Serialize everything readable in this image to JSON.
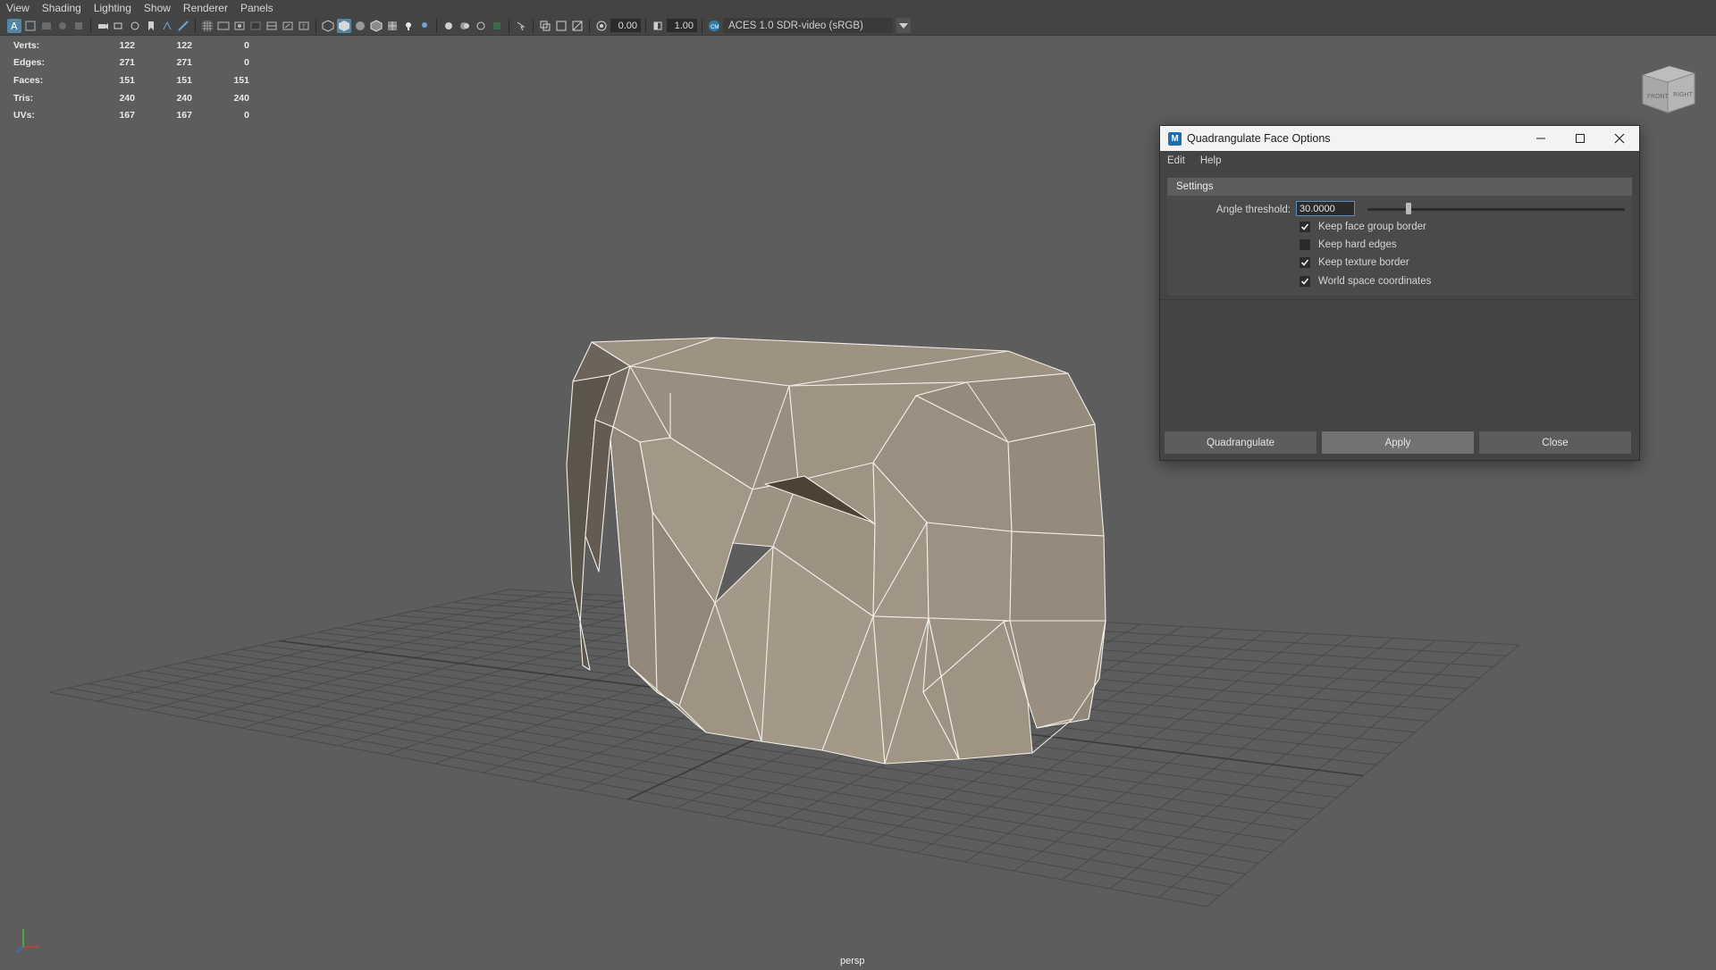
{
  "menubar": {
    "items": [
      "View",
      "Shading",
      "Lighting",
      "Show",
      "Renderer",
      "Panels"
    ]
  },
  "toolbar": {
    "exposure_value": "0.00",
    "gamma_value": "1.00",
    "colorspace": "ACES 1.0 SDR-video (sRGB)",
    "accent_color": "#5285a6"
  },
  "hud": {
    "rows": [
      {
        "label": "Verts:",
        "a": "122",
        "b": "122",
        "c": "0"
      },
      {
        "label": "Edges:",
        "a": "271",
        "b": "271",
        "c": "0"
      },
      {
        "label": "Faces:",
        "a": "151",
        "b": "151",
        "c": "151"
      },
      {
        "label": "Tris:",
        "a": "240",
        "b": "240",
        "c": "240"
      },
      {
        "label": "UVs:",
        "a": "167",
        "b": "167",
        "c": "0"
      }
    ]
  },
  "viewcube": {
    "front": "FRONT",
    "right": "RIGHT"
  },
  "viewport": {
    "camera": "persp",
    "mesh_color": "#a69a8a"
  },
  "dialog": {
    "title": "Quadrangulate Face Options",
    "menu": [
      "Edit",
      "Help"
    ],
    "section": "Settings",
    "angle_label": "Angle threshold:",
    "angle_value": "30.0000",
    "angle_slider_fraction": 0.16,
    "options": [
      {
        "label": "Keep face group border",
        "checked": true
      },
      {
        "label": "Keep hard edges",
        "checked": false
      },
      {
        "label": "Keep texture border",
        "checked": true
      },
      {
        "label": "World space coordinates",
        "checked": true
      }
    ],
    "buttons": {
      "quadrangulate": "Quadrangulate",
      "apply": "Apply",
      "close": "Close"
    }
  }
}
